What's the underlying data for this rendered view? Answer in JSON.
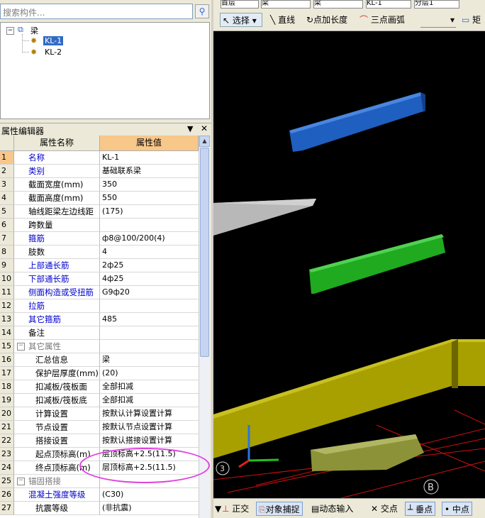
{
  "search": {
    "placeholder": "搜索构件..."
  },
  "tree": {
    "root": "梁",
    "items": [
      {
        "label": "KL-1",
        "selected": true
      },
      {
        "label": "KL-2",
        "selected": false
      }
    ]
  },
  "editor": {
    "title": "属性编辑器",
    "col_name": "属性名称",
    "col_value": "属性值",
    "rows": [
      {
        "no": "1",
        "name": "名称",
        "value": "KL-1"
      },
      {
        "no": "2",
        "name": "类别",
        "value": "基础联系梁"
      },
      {
        "no": "3",
        "name": "截面宽度(mm)",
        "value": "350"
      },
      {
        "no": "4",
        "name": "截面高度(mm)",
        "value": "550"
      },
      {
        "no": "5",
        "name": "轴线距梁左边线距",
        "value": "(175)"
      },
      {
        "no": "6",
        "name": "跨数量",
        "value": ""
      },
      {
        "no": "7",
        "name": "箍筋",
        "value": "ф8@100/200(4)"
      },
      {
        "no": "8",
        "name": "肢数",
        "value": "4"
      },
      {
        "no": "9",
        "name": "上部通长筋",
        "value": "2ф25"
      },
      {
        "no": "10",
        "name": "下部通长筋",
        "value": "4ф25"
      },
      {
        "no": "11",
        "name": "侧面构造或受扭筋",
        "value": "G9ф20"
      },
      {
        "no": "12",
        "name": "拉筋",
        "value": ""
      },
      {
        "no": "13",
        "name": "其它箍筋",
        "value": "485"
      },
      {
        "no": "14",
        "name": "备注",
        "value": ""
      },
      {
        "no": "15",
        "name": "其它属性",
        "value": ""
      },
      {
        "no": "16",
        "name": "汇总信息",
        "value": "梁"
      },
      {
        "no": "17",
        "name": "保护层厚度(mm)",
        "value": "(20)"
      },
      {
        "no": "18",
        "name": "扣减板/筏板面",
        "value": "全部扣减"
      },
      {
        "no": "19",
        "name": "扣减板/筏板底",
        "value": "全部扣减"
      },
      {
        "no": "20",
        "name": "计算设置",
        "value": "按默认计算设置计算"
      },
      {
        "no": "21",
        "name": "节点设置",
        "value": "按默认节点设置计算"
      },
      {
        "no": "22",
        "name": "搭接设置",
        "value": "按默认搭接设置计算"
      },
      {
        "no": "23",
        "name": "起点顶标高(m)",
        "value": "层顶标高+2.5(11.5)"
      },
      {
        "no": "24",
        "name": "终点顶标高(m)",
        "value": "层顶标高+2.5(11.5)"
      },
      {
        "no": "25",
        "name": "锚固搭接",
        "value": ""
      },
      {
        "no": "26",
        "name": "混凝土强度等级",
        "value": "(C30)"
      },
      {
        "no": "27",
        "name": "抗震等级",
        "value": "(非抗震)"
      }
    ]
  },
  "toolbar": {
    "dropdowns": [
      "首层",
      "梁",
      "梁",
      "KL-1",
      "分层1"
    ],
    "select": "选择",
    "line": "直线",
    "point_length": "点加长度",
    "arc": "三点画弧",
    "rect": "矩"
  },
  "status": {
    "ortho": "正交",
    "snap": "对象捕捉",
    "dynamic": "动态输入",
    "intersection": "交点",
    "perpendicular": "垂点",
    "midpoint": "中点"
  },
  "viewport": {
    "axis_label": "B",
    "corner_label": "3"
  },
  "colors": {
    "beam_blue": "#1f5fbf",
    "beam_green": "#1faa1f",
    "slab_yellow": "#a8a000",
    "highlight": "#e040e0"
  }
}
